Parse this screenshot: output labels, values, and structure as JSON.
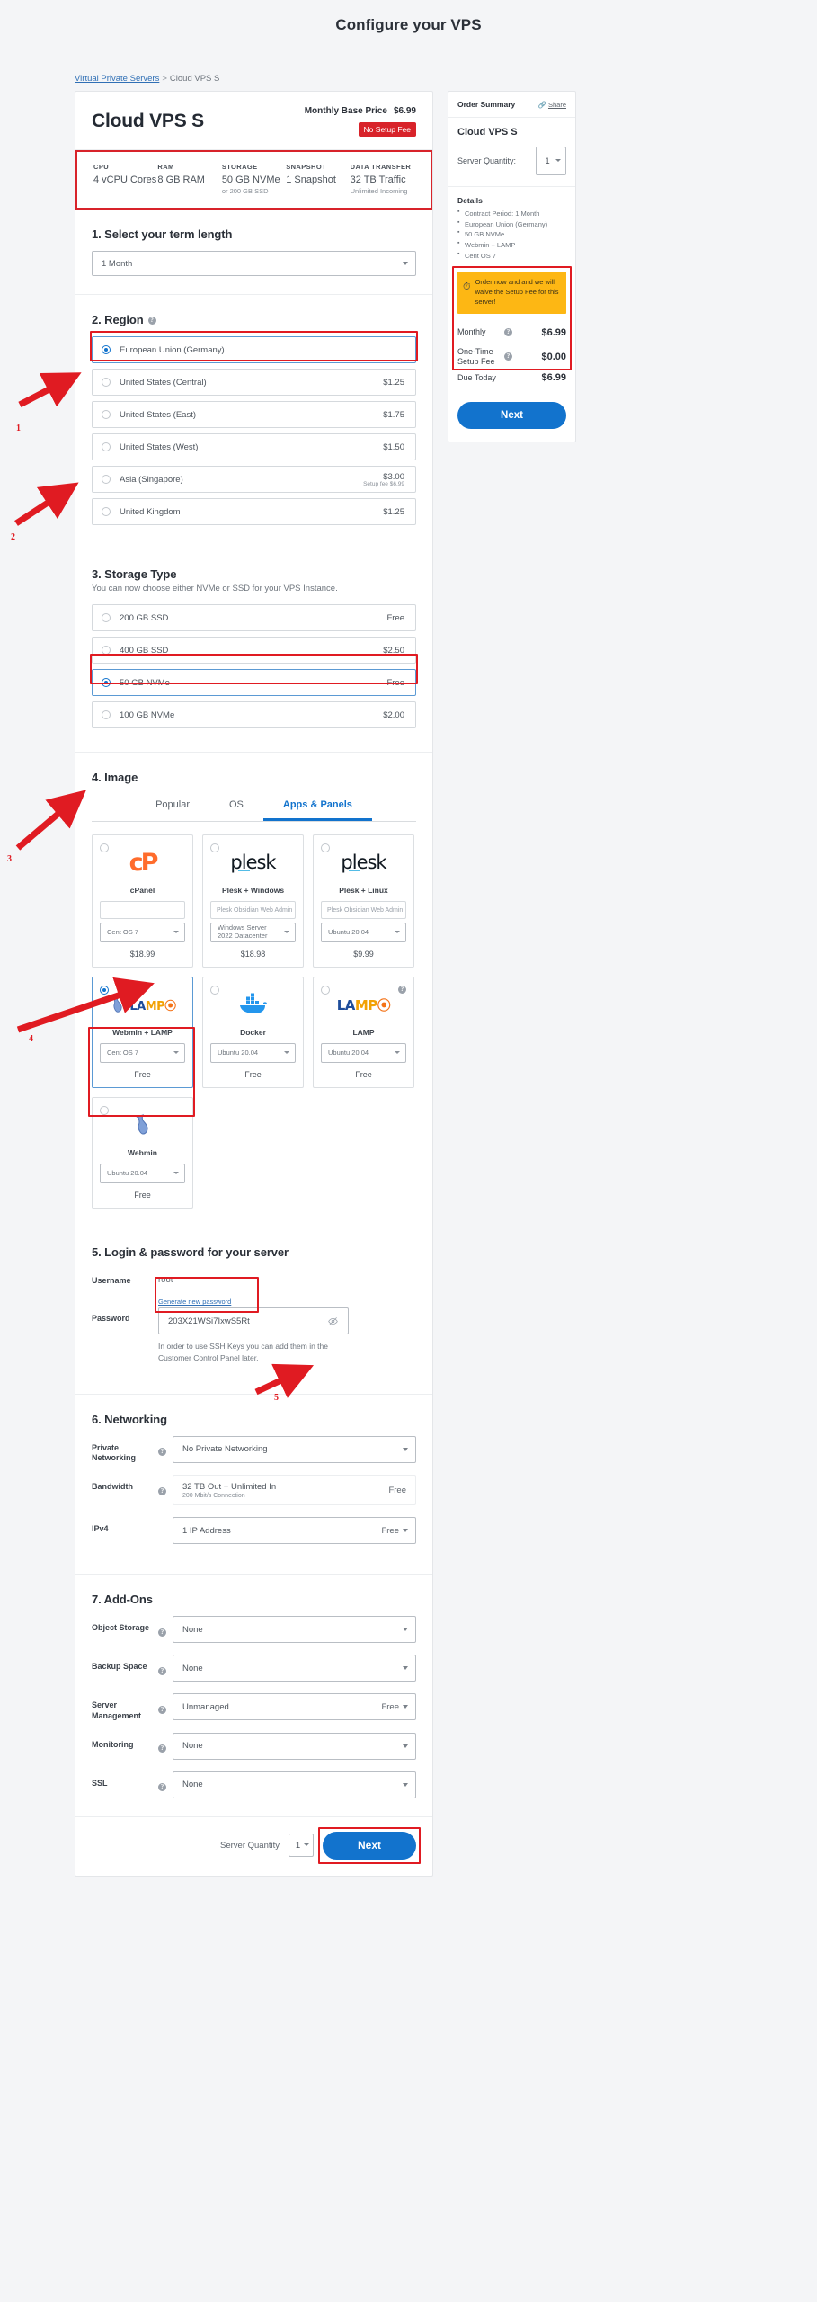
{
  "page": {
    "title": "Configure your VPS"
  },
  "breadcrumb": {
    "root": "Virtual Private Servers",
    "separator": ">",
    "current": "Cloud VPS S"
  },
  "product": {
    "name": "Cloud VPS S",
    "base_price_label": "Monthly Base Price",
    "base_price": "$6.99",
    "setup_badge": "No Setup Fee",
    "specs": [
      {
        "key": "CPU",
        "value": "4 vCPU Cores",
        "sub": ""
      },
      {
        "key": "RAM",
        "value": "8 GB RAM",
        "sub": ""
      },
      {
        "key": "STORAGE",
        "value": "50 GB NVMe",
        "sub": "or 200 GB SSD"
      },
      {
        "key": "SNAPSHOT",
        "value": "1 Snapshot",
        "sub": ""
      },
      {
        "key": "DATA TRANSFER",
        "value": "32 TB Traffic",
        "sub": "Unlimited Incoming"
      }
    ]
  },
  "term": {
    "heading": "1. Select your term length",
    "selected": "1 Month"
  },
  "region": {
    "heading": "2. Region",
    "options": [
      {
        "label": "European Union (Germany)",
        "price": "",
        "setup": "",
        "selected": true
      },
      {
        "label": "United States (Central)",
        "price": "$1.25",
        "setup": "",
        "selected": false
      },
      {
        "label": "United States (East)",
        "price": "$1.75",
        "setup": "",
        "selected": false
      },
      {
        "label": "United States (West)",
        "price": "$1.50",
        "setup": "",
        "selected": false
      },
      {
        "label": "Asia (Singapore)",
        "price": "$3.00",
        "setup": "Setup fee $6.99",
        "selected": false
      },
      {
        "label": "United Kingdom",
        "price": "$1.25",
        "setup": "",
        "selected": false
      }
    ]
  },
  "storage": {
    "heading": "3. Storage Type",
    "description": "You can now choose either NVMe or SSD for your VPS Instance.",
    "options": [
      {
        "label": "200 GB SSD",
        "price": "Free",
        "selected": false
      },
      {
        "label": "400 GB SSD",
        "price": "$2.50",
        "selected": false
      },
      {
        "label": "50 GB NVMe",
        "price": "Free",
        "selected": true
      },
      {
        "label": "100 GB NVMe",
        "price": "$2.00",
        "selected": false
      }
    ]
  },
  "image": {
    "heading": "4. Image",
    "tabs": [
      {
        "label": "Popular",
        "active": false
      },
      {
        "label": "OS",
        "active": false
      },
      {
        "label": "Apps & Panels",
        "active": true
      }
    ],
    "cards": [
      {
        "logo": "cpanel-logo",
        "name": "cPanel",
        "ghost": "",
        "os": "Cent OS 7",
        "price": "$18.99",
        "selected": false,
        "help": false
      },
      {
        "logo": "plesk-logo",
        "name": "Plesk + Windows",
        "ghost": "Plesk Obsidian Web Admin",
        "os": "Windows Server 2022 Datacenter",
        "price": "$18.98",
        "selected": false,
        "help": false
      },
      {
        "logo": "plesk-logo",
        "name": "Plesk + Linux",
        "ghost": "Plesk Obsidian Web Admin",
        "os": "Ubuntu 20.04",
        "price": "$9.99",
        "selected": false,
        "help": false
      },
      {
        "logo": "webmin-lamp-logo",
        "name": "Webmin + LAMP",
        "ghost": "",
        "os": "Cent OS 7",
        "price": "Free",
        "selected": true,
        "help": false
      },
      {
        "logo": "docker-logo",
        "name": "Docker",
        "ghost": "",
        "os": "Ubuntu 20.04",
        "price": "Free",
        "selected": false,
        "help": false
      },
      {
        "logo": "lamp-logo",
        "name": "LAMP",
        "ghost": "",
        "os": "Ubuntu 20.04",
        "price": "Free",
        "selected": false,
        "help": true
      },
      {
        "logo": "webmin-logo",
        "name": "Webmin",
        "ghost": "",
        "os": "Ubuntu 20.04",
        "price": "Free",
        "selected": false,
        "help": false
      }
    ]
  },
  "login": {
    "heading": "5. Login & password for your server",
    "username_label": "Username",
    "username_value": "root",
    "password_label": "Password",
    "generate_link": "Generate new password",
    "password_value": "203X21WSi7IxwS5Rt",
    "note": "In order to use SSH Keys you can add them in the Customer Control Panel later."
  },
  "networking": {
    "heading": "6. Networking",
    "rows": [
      {
        "label": "Private Networking",
        "value": "No Private Networking",
        "sub": "",
        "price": "",
        "caret": true,
        "help": true,
        "plain": false
      },
      {
        "label": "Bandwidth",
        "value": "32 TB Out + Unlimited In",
        "sub": "200 Mbit/s Connection",
        "price": "Free",
        "caret": false,
        "help": true,
        "plain": true
      },
      {
        "label": "IPv4",
        "value": "1 IP Address",
        "sub": "",
        "price": "Free",
        "caret": true,
        "help": false,
        "plain": false
      }
    ]
  },
  "addons": {
    "heading": "7. Add-Ons",
    "rows": [
      {
        "label": "Object Storage",
        "value": "None",
        "price": "",
        "help": true
      },
      {
        "label": "Backup Space",
        "value": "None",
        "price": "",
        "help": true
      },
      {
        "label": "Server Management",
        "value": "Unmanaged",
        "price": "Free",
        "help": true
      },
      {
        "label": "Monitoring",
        "value": "None",
        "price": "",
        "help": true
      },
      {
        "label": "SSL",
        "value": "None",
        "price": "",
        "help": true
      }
    ]
  },
  "footer": {
    "quantity_label": "Server Quantity",
    "quantity_value": "1",
    "next_label": "Next"
  },
  "sidebar": {
    "title": "Order Summary",
    "share_label": "Share",
    "product_name": "Cloud VPS S",
    "quantity_label": "Server Quantity:",
    "quantity_value": "1",
    "details_title": "Details",
    "details": [
      "Contract Period: 1 Month",
      "European Union (Germany)",
      "50 GB NVMe",
      "Webmin + LAMP",
      "Cent OS 7"
    ],
    "promo": "Order now and and we will waive the Setup Fee for this server!",
    "prices": [
      {
        "label": "Monthly",
        "value": "$6.99",
        "help": true
      },
      {
        "label": "One-Time Setup Fee",
        "value": "$0.00",
        "help": true
      },
      {
        "label": "Due Today",
        "value": "$6.99",
        "help": false
      }
    ],
    "next_label": "Next"
  },
  "annotations": {
    "numbers": [
      "1",
      "2",
      "3",
      "4",
      "5"
    ]
  },
  "colors": {
    "accent": "#1273cd",
    "highlight": "#e01b22",
    "promo": "#fdb714",
    "badge": "#d8232a"
  }
}
